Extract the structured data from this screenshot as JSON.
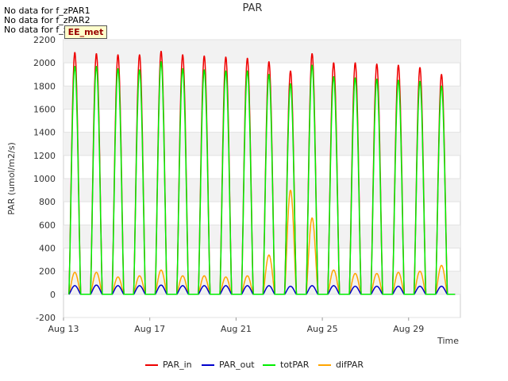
{
  "messages": [
    "No data for f_zPAR1",
    "No data for f_zPAR2",
    "No data for f_zPAR3"
  ],
  "badge": "EE_met",
  "chart_data": {
    "type": "line",
    "title": "PAR",
    "ylabel": "PAR (umol/m2/s)",
    "xlabel": "Time",
    "ylim": [
      -200,
      2200
    ],
    "yticks": [
      -200,
      0,
      200,
      400,
      600,
      800,
      1000,
      1200,
      1400,
      1600,
      1800,
      2000,
      2200
    ],
    "xlim_days": [
      13,
      31.4
    ],
    "xticks": [
      {
        "day": 13,
        "label": "Aug 13"
      },
      {
        "day": 17,
        "label": "Aug 17"
      },
      {
        "day": 21,
        "label": "Aug 21"
      },
      {
        "day": 25,
        "label": "Aug 25"
      },
      {
        "day": 29,
        "label": "Aug 29"
      }
    ],
    "grid": true,
    "legend_position": "bottom",
    "day_start": 13.25,
    "day_end": 31.15,
    "daily_peaks": {
      "dates": [
        "Aug 13",
        "Aug 14",
        "Aug 15",
        "Aug 16",
        "Aug 17",
        "Aug 18",
        "Aug 19",
        "Aug 20",
        "Aug 21",
        "Aug 22",
        "Aug 23",
        "Aug 24",
        "Aug 25",
        "Aug 26",
        "Aug 27",
        "Aug 28",
        "Aug 29",
        "Aug 30"
      ],
      "PAR_in": [
        2090,
        2080,
        2070,
        2070,
        2100,
        2070,
        2060,
        2050,
        2040,
        2010,
        1930,
        2080,
        2000,
        2000,
        1990,
        1980,
        1960,
        1900
      ],
      "PAR_out": [
        75,
        80,
        75,
        75,
        80,
        75,
        75,
        75,
        75,
        75,
        70,
        75,
        75,
        70,
        70,
        70,
        70,
        70
      ],
      "totPAR": [
        1970,
        1970,
        1950,
        1940,
        2010,
        1950,
        1940,
        1930,
        1930,
        1900,
        1820,
        1980,
        1880,
        1870,
        1860,
        1850,
        1840,
        1800
      ],
      "difPAR": [
        190,
        190,
        150,
        160,
        210,
        160,
        160,
        150,
        160,
        340,
        900,
        660,
        210,
        180,
        180,
        190,
        200,
        250
      ]
    },
    "series": [
      {
        "name": "PAR_in",
        "color": "#ee0000"
      },
      {
        "name": "PAR_out",
        "color": "#0000cc"
      },
      {
        "name": "totPAR",
        "color": "#00ee00"
      },
      {
        "name": "difPAR",
        "color": "#ffa500"
      }
    ]
  }
}
